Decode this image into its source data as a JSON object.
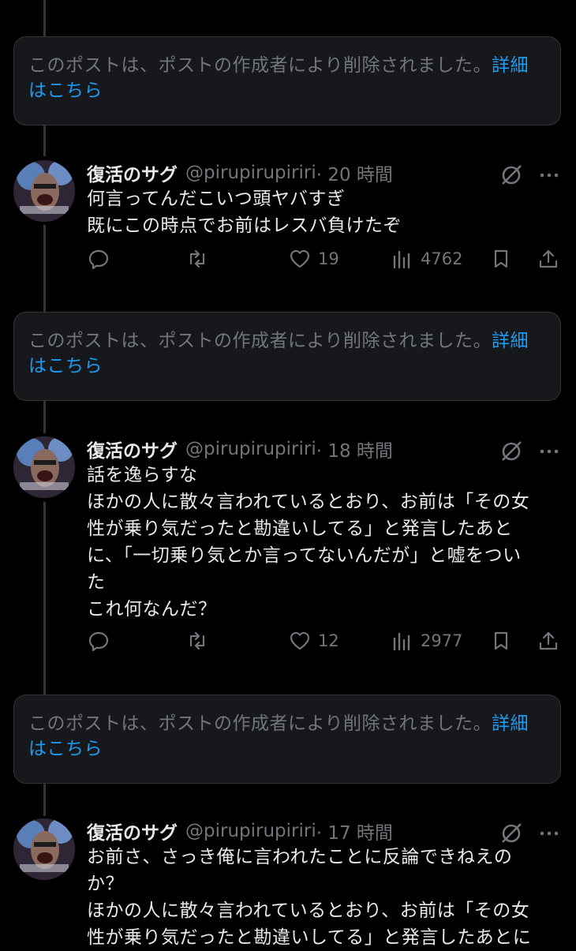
{
  "deleted_notice": {
    "text": "このポストは、ポストの作成者により削除されました。",
    "link": "詳細はこちら"
  },
  "posts": [
    {
      "author_name": "復活のサグ",
      "handle": "@pirupirupiriri",
      "time": "· 20 時間",
      "lines": [
        "何言ってんだこいつ頭ヤバすぎ",
        "既にこの時点でお前はレスバ負けたぞ"
      ],
      "likes": "19",
      "views": "4762"
    },
    {
      "author_name": "復活のサグ",
      "handle": "@pirupirupiriri",
      "time": "· 18 時間",
      "lines": [
        "話を逸らすな",
        "ほかの人に散々言われているとおり、お前は「その女",
        "性が乗り気だったと勘違いしてる」と発言したあと",
        "に、「一切乗り気とか言ってないんだが」と嘘をつい",
        "た",
        "これ何なんだ？"
      ],
      "likes": "12",
      "views": "2977"
    },
    {
      "author_name": "復活のサグ",
      "handle": "@pirupirupiriri",
      "time": "· 17 時間",
      "lines": [
        "お前さ、さっき俺に言われたことに反論できねえの",
        "か？",
        "ほかの人に散々言われているとおり、お前は「その女",
        "性が乗り気だったと勘違いしてる」と発言したあとに"
      ]
    }
  ],
  "icons": {
    "reply": "reply-icon",
    "repost": "repost-icon",
    "like": "heart-icon",
    "views": "views-icon",
    "bookmark": "bookmark-icon",
    "share": "share-icon",
    "grok": "grok-icon",
    "more": "more-icon"
  },
  "colors": {
    "background": "#000000",
    "card": "#16181c",
    "text": "#e7e9ea",
    "muted": "#71767b",
    "link": "#1d9bf0"
  }
}
